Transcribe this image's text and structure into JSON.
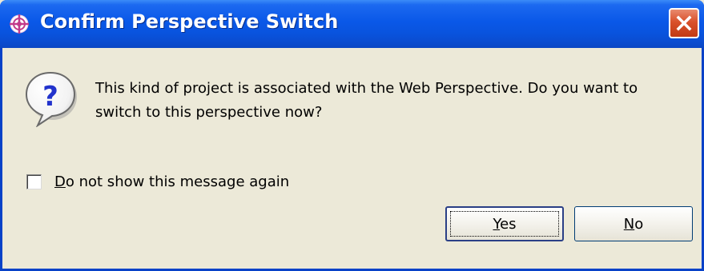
{
  "window": {
    "title": "Confirm Perspective Switch",
    "title_icon": "perspective-icon",
    "close_icon": "close-icon"
  },
  "dialog": {
    "icon": "question-icon",
    "message": "This kind of project is associated with the Web Perspective.  Do you want to switch to this perspective now?",
    "checkbox": {
      "mnemonic": "D",
      "label_rest": "o not show this message again",
      "checked": false
    },
    "buttons": {
      "yes": {
        "mnemonic": "Y",
        "rest": "es",
        "default": true
      },
      "no": {
        "mnemonic": "N",
        "rest": "o"
      }
    }
  },
  "colors": {
    "titlebar": "#0A58E8",
    "face": "#ECE9D8",
    "close": "#D9512B",
    "icon_accent": "#2233CC"
  }
}
